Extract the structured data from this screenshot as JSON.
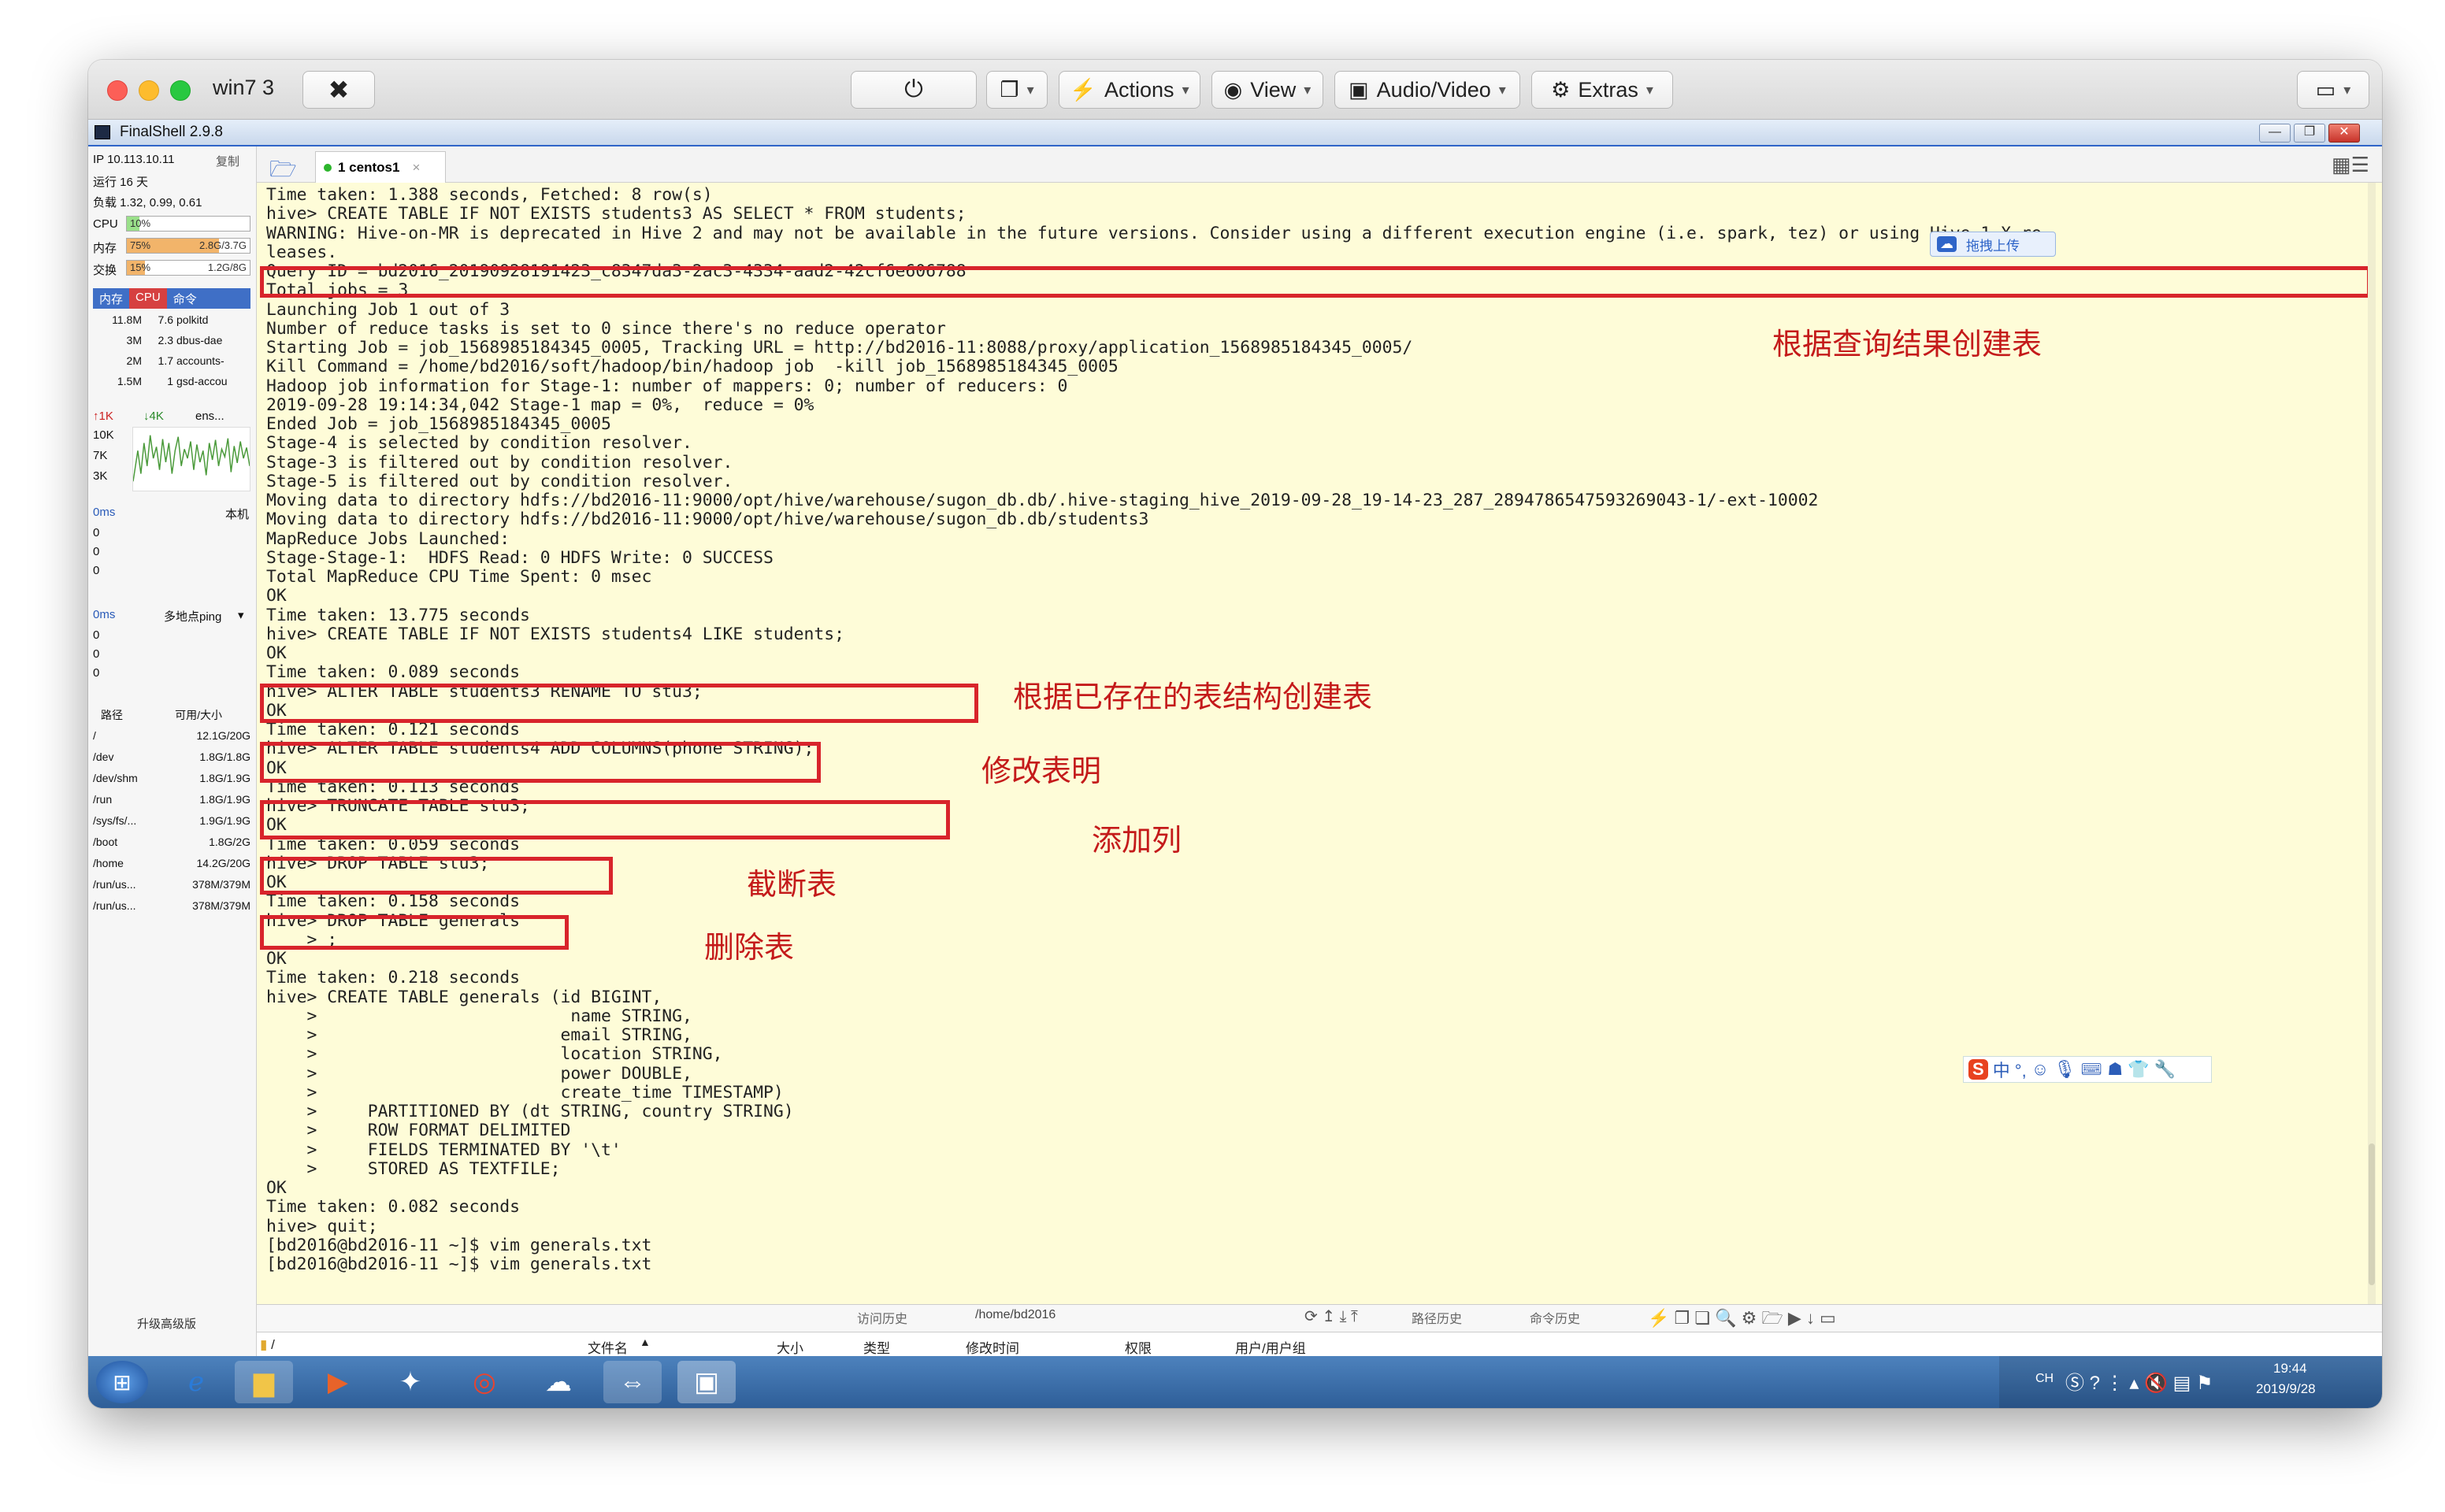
{
  "mac": {
    "title": "win7 3",
    "toolbar": {
      "actions": "Actions",
      "view": "View",
      "audio_video": "Audio/Video",
      "extras": "Extras"
    }
  },
  "app": {
    "title": "FinalShell 2.9.8"
  },
  "sidebar": {
    "ip": "IP 10.113.10.11",
    "copy": "复制",
    "uptime": "运行 16 天",
    "load": "负载 1.32, 0.99, 0.61",
    "cpu_label": "CPU",
    "cpu_value": "10%",
    "cpu_percent": 10,
    "mem_label": "内存",
    "mem_value": "75%",
    "mem_percent": 75,
    "mem_size": "2.8G/3.7G",
    "swap_label": "交换",
    "swap_value": "15%",
    "swap_percent": 15,
    "swap_size": "1.2G/8G",
    "proc_tabs": [
      "内存",
      "CPU",
      "命令"
    ],
    "processes": [
      {
        "mem": "11.8M",
        "cpu": "7.6",
        "cmd": "polkitd"
      },
      {
        "mem": "3M",
        "cpu": "2.3",
        "cmd": "dbus-dae"
      },
      {
        "mem": "2M",
        "cpu": "1.7",
        "cmd": "accounts-"
      },
      {
        "mem": "1.5M",
        "cpu": "1",
        "cmd": "gsd-accou"
      }
    ],
    "net_up": "↑1K",
    "net_down": "↓4K",
    "net_iface": "ens...",
    "net_ticks": [
      "10K",
      "7K",
      "3K"
    ],
    "ping_local_ms": "0ms",
    "ping_local_label": "本机",
    "ping_local_vals": [
      "0",
      "0",
      "0"
    ],
    "ping_multi_ms": "0ms",
    "ping_multi_label": "多地点ping",
    "ping_multi_vals": [
      "0",
      "0",
      "0"
    ],
    "disk_head_path": "路径",
    "disk_head_size": "可用/大小",
    "disks": [
      {
        "path": "/",
        "size": "12.1G/20G"
      },
      {
        "path": "/dev",
        "size": "1.8G/1.8G"
      },
      {
        "path": "/dev/shm",
        "size": "1.8G/1.9G"
      },
      {
        "path": "/run",
        "size": "1.8G/1.9G"
      },
      {
        "path": "/sys/fs/...",
        "size": "1.9G/1.9G"
      },
      {
        "path": "/boot",
        "size": "1.8G/2G"
      },
      {
        "path": "/home",
        "size": "14.2G/20G"
      },
      {
        "path": "/run/us...",
        "size": "378M/379M"
      },
      {
        "path": "/run/us...",
        "size": "378M/379M"
      }
    ],
    "upgrade": "升级高级版"
  },
  "tab": {
    "label": "1 centos1"
  },
  "upload": "拖拽上传",
  "terminal": {
    "lines": [
      "Time taken: 1.388 seconds, Fetched: 8 row(s)",
      "hive> CREATE TABLE IF NOT EXISTS students3 AS SELECT * FROM students;",
      "WARNING: Hive-on-MR is deprecated in Hive 2 and may not be available in the future versions. Consider using a different execution engine (i.e. spark, tez) or using Hive 1.X re",
      "leases.",
      "Query ID = bd2016_20190928191423_c8347da3-2ac3-4334-aad2-42cf6e606788",
      "Total jobs = 3",
      "Launching Job 1 out of 3",
      "Number of reduce tasks is set to 0 since there's no reduce operator",
      "Starting Job = job_1568985184345_0005, Tracking URL = http://bd2016-11:8088/proxy/application_1568985184345_0005/",
      "Kill Command = /home/bd2016/soft/hadoop/bin/hadoop job  -kill job_1568985184345_0005",
      "Hadoop job information for Stage-1: number of mappers: 0; number of reducers: 0",
      "2019-09-28 19:14:34,042 Stage-1 map = 0%,  reduce = 0%",
      "Ended Job = job_1568985184345_0005",
      "Stage-4 is selected by condition resolver.",
      "Stage-3 is filtered out by condition resolver.",
      "Stage-5 is filtered out by condition resolver.",
      "Moving data to directory hdfs://bd2016-11:9000/opt/hive/warehouse/sugon_db.db/.hive-staging_hive_2019-09-28_19-14-23_287_2894786547593269043-1/-ext-10002",
      "Moving data to directory hdfs://bd2016-11:9000/opt/hive/warehouse/sugon_db.db/students3",
      "MapReduce Jobs Launched:",
      "Stage-Stage-1:  HDFS Read: 0 HDFS Write: 0 SUCCESS",
      "Total MapReduce CPU Time Spent: 0 msec",
      "OK",
      "Time taken: 13.775 seconds",
      "hive> CREATE TABLE IF NOT EXISTS students4 LIKE students;",
      "OK",
      "Time taken: 0.089 seconds",
      "hive> ALTER TABLE students3 RENAME TO stu3;",
      "OK",
      "Time taken: 0.121 seconds",
      "hive> ALTER TABLE students4 ADD COLUMNS(phone STRING);",
      "OK",
      "Time taken: 0.113 seconds",
      "hive> TRUNCATE TABLE stu3;",
      "OK",
      "Time taken: 0.059 seconds",
      "hive> DROP TABLE stu3;",
      "OK",
      "Time taken: 0.158 seconds",
      "hive> DROP TABLE generals",
      "    > ;",
      "OK",
      "Time taken: 0.218 seconds",
      "hive> CREATE TABLE generals (id BIGINT,",
      "    >                         name STRING,",
      "    >                        email STRING,",
      "    >                        location STRING,",
      "    >                        power DOUBLE,",
      "    >                        create_time TIMESTAMP)",
      "    >     PARTITIONED BY (dt STRING, country STRING)",
      "    >     ROW FORMAT DELIMITED",
      "    >     FIELDS TERMINATED BY '\\t'",
      "    >     STORED AS TEXTFILE;",
      "OK",
      "Time taken: 0.082 seconds",
      "hive> quit;",
      "[bd2016@bd2016-11 ~]$ vim generals.txt",
      "[bd2016@bd2016-11 ~]$ vim generals.txt"
    ]
  },
  "annotations": {
    "create_as_select": "根据查询结果创建表",
    "create_like": "根据已存在的表结构创建表",
    "rename": "修改表明",
    "add_column": "添加列",
    "truncate": "截断表",
    "drop": "删除表"
  },
  "bottom": {
    "history": "访问历史",
    "path": "/home/bd2016",
    "path_history": "路径历史",
    "cmd_history": "命令历史",
    "dir": "/",
    "cols": [
      "文件名",
      "大小",
      "类型",
      "修改时间",
      "权限",
      "用户/用户组"
    ]
  },
  "sogou": "中 °,",
  "taskbar": {
    "lang": "CH",
    "time": "19:44",
    "date": "2019/9/28"
  },
  "colors": {
    "highlight": "#d8242b",
    "annotation": "#c41a1a",
    "terminal_bg": "#fefcd8",
    "accent": "#2f65c8"
  }
}
